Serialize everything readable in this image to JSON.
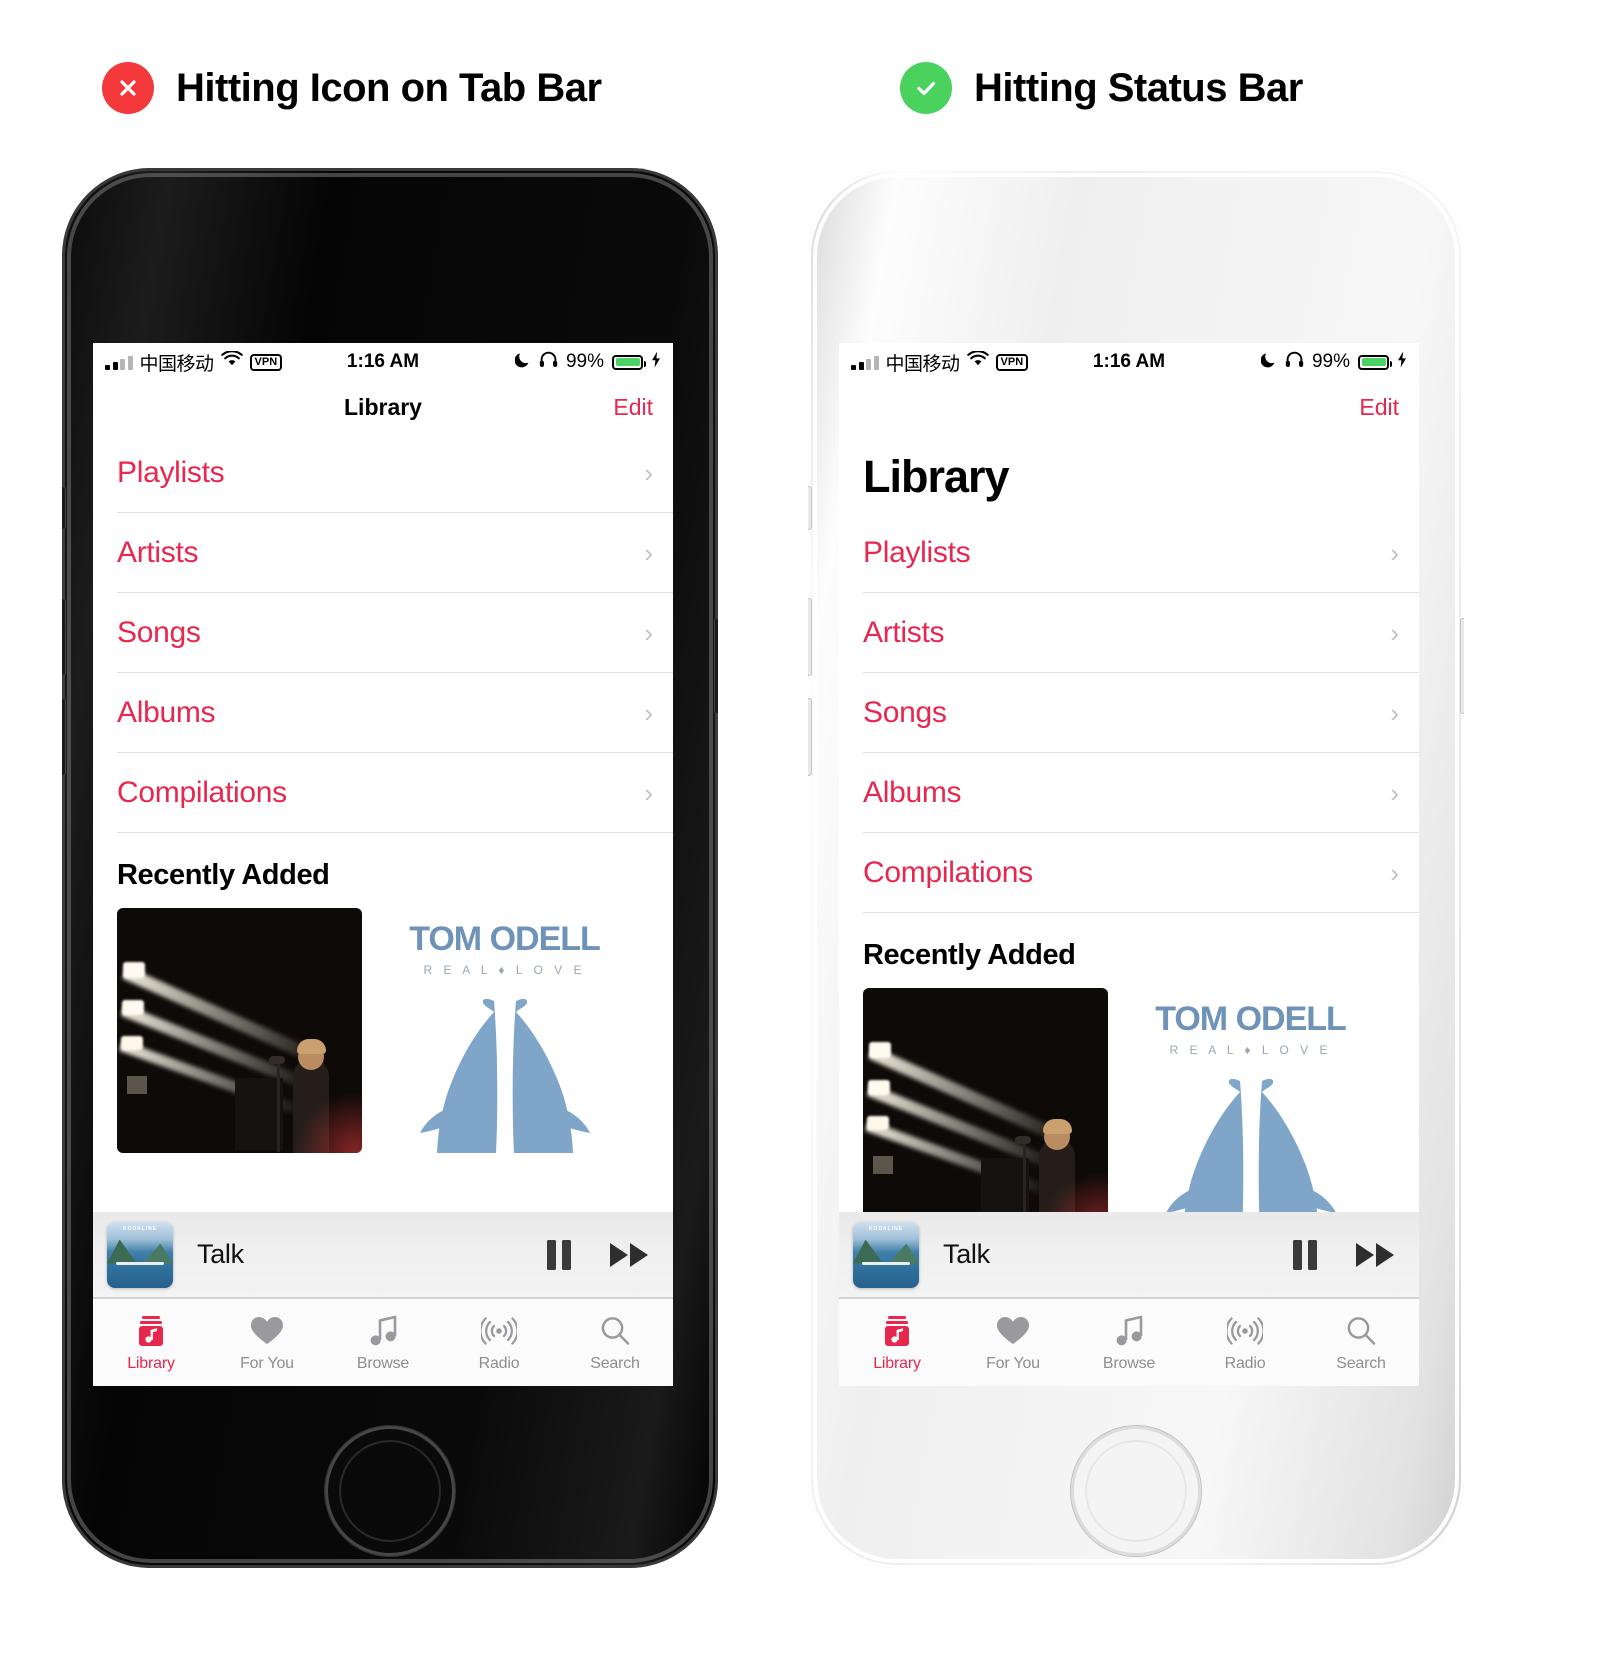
{
  "panels": [
    {
      "heading": {
        "badge": "x-circle-icon",
        "badge_color": "#f4393c",
        "text": "Hitting Icon on Tab Bar"
      },
      "frame_finish": "jet-black",
      "screen": {
        "statusbar": {
          "carrier": "中国移动",
          "vpn": "VPN",
          "time": "1:16 AM",
          "battery_pct": "99%",
          "icons": [
            "signal-bars-icon",
            "wifi-icon",
            "vpn-badge",
            "moon-icon",
            "headphones-icon",
            "battery-icon",
            "charging-bolt-icon"
          ],
          "battery_color": "#4cd264"
        },
        "navbar": {
          "title": "Library",
          "edit_label": "Edit"
        },
        "large_title": "",
        "list": [
          {
            "label": "Playlists"
          },
          {
            "label": "Artists"
          },
          {
            "label": "Songs"
          },
          {
            "label": "Albums"
          },
          {
            "label": "Compilations"
          }
        ],
        "section_title": "Recently Added",
        "albums": [
          {
            "kind": "concert-photo",
            "title": ""
          },
          {
            "kind": "tom-odell",
            "artist": "TOM ODELL",
            "album": "R E A L  ♦  L O V E"
          }
        ],
        "miniplayer": {
          "track": "Talk",
          "artwork_label": "KODALINE",
          "pause_icon": "pause-icon",
          "next_icon": "fast-forward-icon"
        },
        "tabs": [
          {
            "label": "Library",
            "icon": "library-icon",
            "active": true
          },
          {
            "label": "For You",
            "icon": "heart-icon",
            "active": false
          },
          {
            "label": "Browse",
            "icon": "music-note-icon",
            "active": false
          },
          {
            "label": "Radio",
            "icon": "radio-waves-icon",
            "active": false
          },
          {
            "label": "Search",
            "icon": "search-icon",
            "active": false
          }
        ]
      }
    },
    {
      "heading": {
        "badge": "check-circle-icon",
        "badge_color": "#4ad15e",
        "text": "Hitting Status Bar"
      },
      "frame_finish": "silver",
      "screen": {
        "statusbar": {
          "carrier": "中国移动",
          "vpn": "VPN",
          "time": "1:16 AM",
          "battery_pct": "99%",
          "icons": [
            "signal-bars-icon",
            "wifi-icon",
            "vpn-badge",
            "moon-icon",
            "headphones-icon",
            "battery-icon",
            "charging-bolt-icon"
          ],
          "battery_color": "#4cd264"
        },
        "navbar": {
          "title": "",
          "edit_label": "Edit"
        },
        "large_title": "Library",
        "list": [
          {
            "label": "Playlists"
          },
          {
            "label": "Artists"
          },
          {
            "label": "Songs"
          },
          {
            "label": "Albums"
          },
          {
            "label": "Compilations"
          }
        ],
        "section_title": "Recently Added",
        "albums": [
          {
            "kind": "concert-photo",
            "title": ""
          },
          {
            "kind": "tom-odell",
            "artist": "TOM ODELL",
            "album": "R E A L  ♦  L O V E"
          }
        ],
        "miniplayer": {
          "track": "Talk",
          "artwork_label": "KODALINE",
          "pause_icon": "pause-icon",
          "next_icon": "fast-forward-icon"
        },
        "tabs": [
          {
            "label": "Library",
            "icon": "library-icon",
            "active": true
          },
          {
            "label": "For You",
            "icon": "heart-icon",
            "active": false
          },
          {
            "label": "Browse",
            "icon": "music-note-icon",
            "active": false
          },
          {
            "label": "Radio",
            "icon": "radio-waves-icon",
            "active": false
          },
          {
            "label": "Search",
            "icon": "search-icon",
            "active": false
          }
        ]
      }
    }
  ],
  "theme": {
    "accent_red": "#e8274f",
    "tab_inactive": "#8e8e93",
    "separator": "#e2e2e2",
    "odell_blue": "#7fa5c9"
  }
}
